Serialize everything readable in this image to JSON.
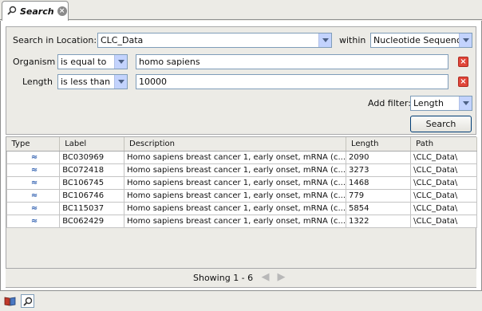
{
  "tab": {
    "title": "Search",
    "icon": "magnifier-icon",
    "close_icon": "close-icon"
  },
  "form": {
    "location_label": "Search in Location:",
    "location_value": "CLC_Data",
    "within_label": "within",
    "within_value": "Nucleotide Sequence",
    "filters": [
      {
        "field": "Organism",
        "operator": "is equal to",
        "value": "homo sapiens"
      },
      {
        "field": "Length",
        "operator": "is less than",
        "value": "10000"
      }
    ],
    "add_filter_label": "Add filter:",
    "add_filter_value": "Length",
    "search_button": "Search"
  },
  "table": {
    "columns": [
      "Type",
      "Label",
      "Description",
      "Length",
      "Path"
    ],
    "rows": [
      {
        "type_icon": "nucleotide-sequence-icon",
        "label": "BC030969",
        "description": "Homo sapiens breast cancer 1, early onset, mRNA (c...",
        "length": "2090",
        "path": "\\CLC_Data\\"
      },
      {
        "type_icon": "nucleotide-sequence-icon",
        "label": "BC072418",
        "description": "Homo sapiens breast cancer 1, early onset, mRNA (c...",
        "length": "3273",
        "path": "\\CLC_Data\\"
      },
      {
        "type_icon": "nucleotide-sequence-icon",
        "label": "BC106745",
        "description": "Homo sapiens breast cancer 1, early onset, mRNA (c...",
        "length": "1468",
        "path": "\\CLC_Data\\"
      },
      {
        "type_icon": "nucleotide-sequence-icon",
        "label": "BC106746",
        "description": "Homo sapiens breast cancer 1, early onset, mRNA (c...",
        "length": "779",
        "path": "\\CLC_Data\\"
      },
      {
        "type_icon": "nucleotide-sequence-icon",
        "label": "BC115037",
        "description": "Homo sapiens breast cancer 1, early onset, mRNA (c...",
        "length": "5854",
        "path": "\\CLC_Data\\"
      },
      {
        "type_icon": "nucleotide-sequence-icon",
        "label": "BC062429",
        "description": "Homo sapiens breast cancer 1, early onset, mRNA (c...",
        "length": "1322",
        "path": "\\CLC_Data\\"
      }
    ]
  },
  "status": {
    "showing": "Showing 1 - 6",
    "prev_icon": "arrow-left-icon",
    "next_icon": "arrow-right-icon"
  },
  "bottom_bar": {
    "icons": [
      "book-icon",
      "search-view-icon"
    ]
  },
  "colors": {
    "delete": "#e0463a",
    "selection_border": "#7f9db9",
    "panel_bg": "#ecebe6"
  }
}
